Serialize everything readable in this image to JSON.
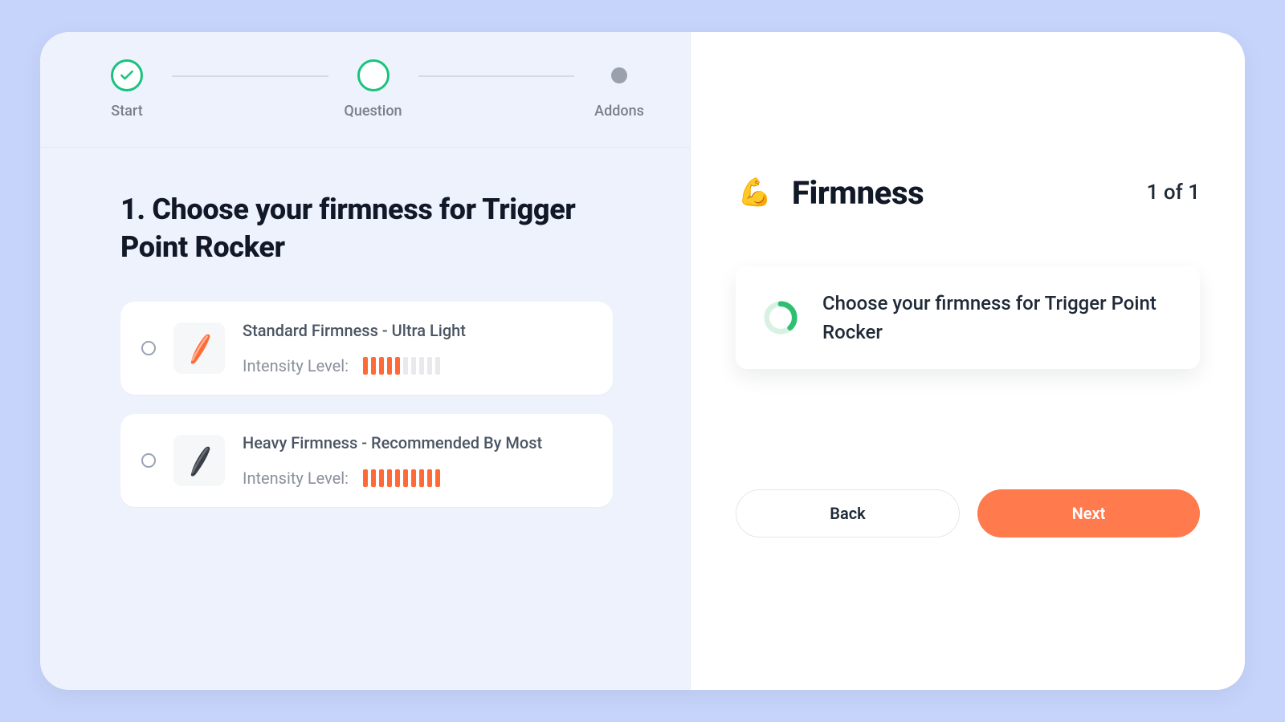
{
  "stepper": {
    "steps": [
      {
        "label": "Start",
        "state": "done"
      },
      {
        "label": "Question",
        "state": "current"
      },
      {
        "label": "Addons",
        "state": "upcoming"
      }
    ]
  },
  "left": {
    "question_number": "1.",
    "question_title": "1. Choose your firmness for Trigger Point Rocker",
    "intensity_label": "Intensity Level:",
    "options": [
      {
        "title": "Standard Firmness - Ultra Light",
        "intensity_filled": 5,
        "intensity_total": 10,
        "color": "#ff6a36"
      },
      {
        "title": "Heavy Firmness - Recommended By Most",
        "intensity_filled": 10,
        "intensity_total": 10,
        "color": "#3a3f47"
      }
    ]
  },
  "right": {
    "emoji": "💪",
    "title": "Firmness",
    "progress": "1 of 1",
    "summary": "Choose your firmness for Trigger Point Rocker",
    "back_label": "Back",
    "next_label": "Next"
  },
  "colors": {
    "accent_green": "#19c37d",
    "accent_orange": "#ff7a4d",
    "page_bg": "#c6d4fb",
    "left_bg": "#eef2fc"
  }
}
